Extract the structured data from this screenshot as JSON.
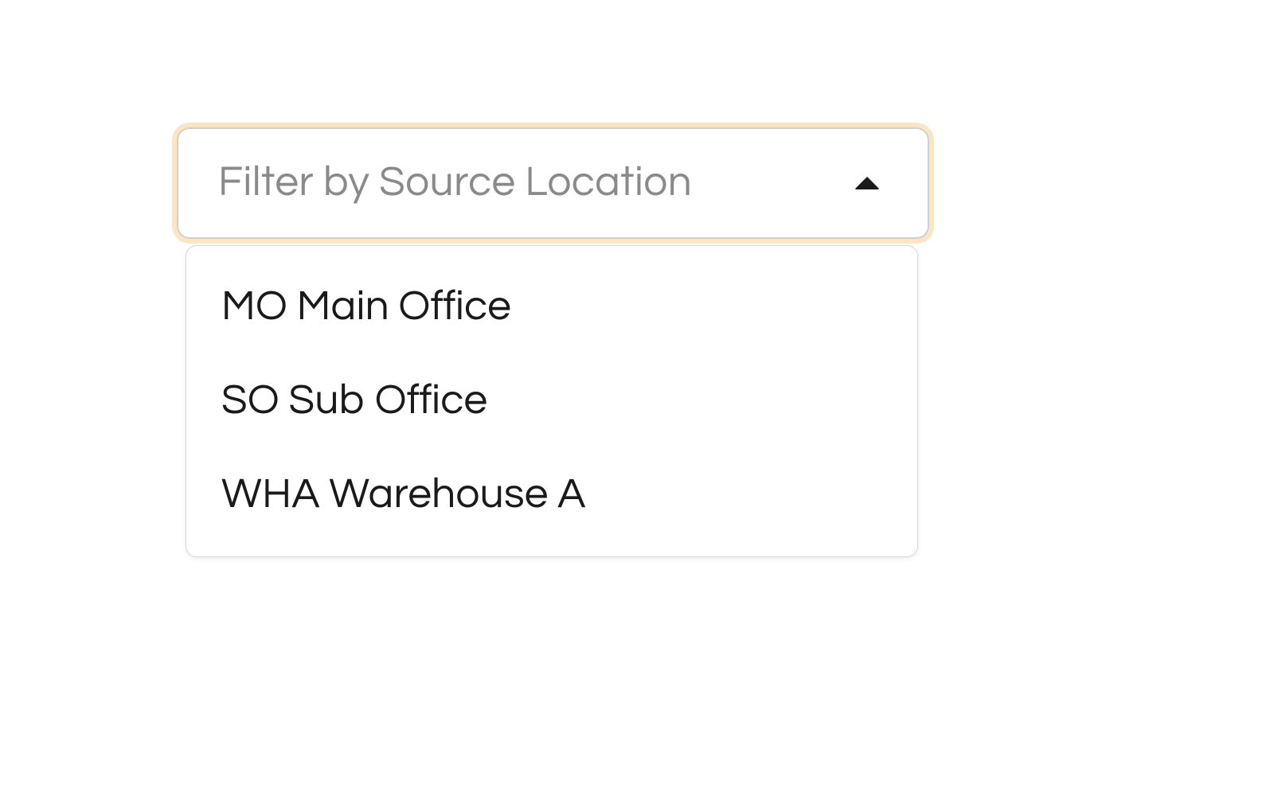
{
  "dropdown": {
    "placeholder": "Filter by Source Location",
    "options": [
      "MO Main Office",
      "SO Sub Office",
      "WHA Warehouse A"
    ]
  }
}
